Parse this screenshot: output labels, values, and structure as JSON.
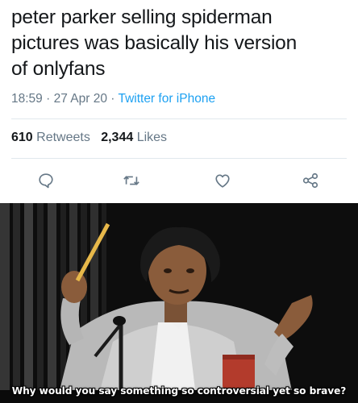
{
  "tweet": {
    "text_lines": [
      "peter parker selling spiderman",
      "pictures was basically his version",
      "of onlyfans"
    ],
    "time": "18:59",
    "date": "27 Apr 20",
    "source": "Twitter for iPhone",
    "retweets_count": "610",
    "retweets_label": "Retweets",
    "likes_count": "2,344",
    "likes_label": "Likes"
  },
  "actions": [
    {
      "icon": "reply-icon"
    },
    {
      "icon": "retweet-icon"
    },
    {
      "icon": "like-icon"
    },
    {
      "icon": "share-icon"
    }
  ],
  "meme": {
    "caption": "Why would you say something so controversial yet so brave?"
  },
  "colors": {
    "text": "#14171a",
    "secondary": "#657786",
    "link": "#1da1f2",
    "divider": "#e1e8ed"
  }
}
